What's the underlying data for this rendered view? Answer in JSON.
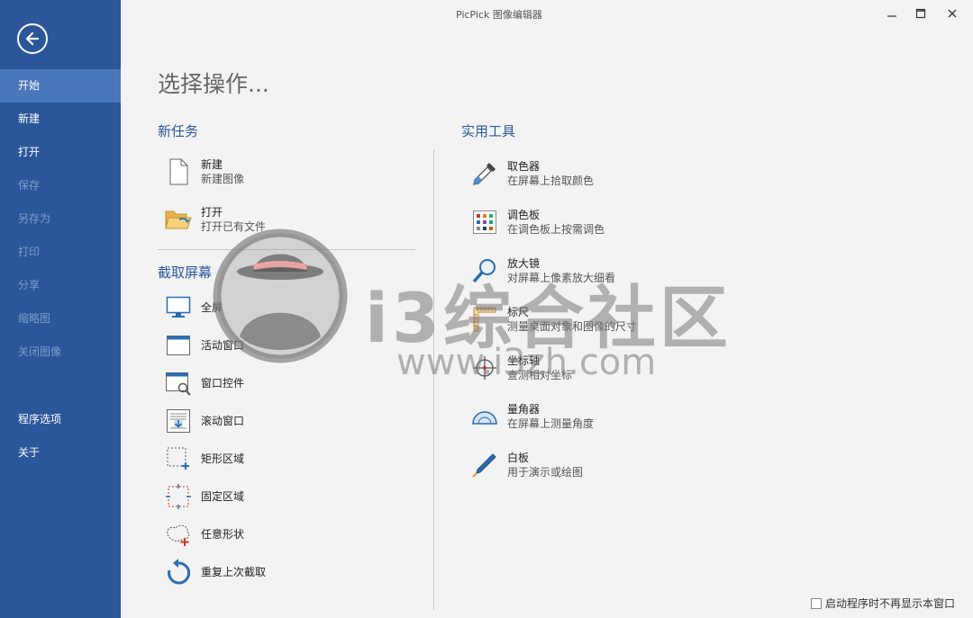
{
  "window": {
    "title": "PicPick 图像编辑器"
  },
  "sidebar": {
    "items": [
      {
        "label": "开始"
      },
      {
        "label": "新建"
      },
      {
        "label": "打开"
      },
      {
        "label": "保存"
      },
      {
        "label": "另存为"
      },
      {
        "label": "打印"
      },
      {
        "label": "分享"
      },
      {
        "label": "缩略图"
      },
      {
        "label": "关闭图像"
      },
      {
        "label": "程序选项"
      },
      {
        "label": "关于"
      }
    ]
  },
  "main": {
    "heading": "选择操作...",
    "new_task": {
      "title": "新任务",
      "items": [
        {
          "name": "新建",
          "desc": "新建图像"
        },
        {
          "name": "打开",
          "desc": "打开已有文件"
        }
      ]
    },
    "capture": {
      "title": "截取屏幕",
      "items": [
        {
          "name": "全屏"
        },
        {
          "name": "活动窗口"
        },
        {
          "name": "窗口控件"
        },
        {
          "name": "滚动窗口"
        },
        {
          "name": "矩形区域"
        },
        {
          "name": "固定区域"
        },
        {
          "name": "任意形状"
        },
        {
          "name": "重复上次截取"
        }
      ]
    },
    "tools": {
      "title": "实用工具",
      "items": [
        {
          "name": "取色器",
          "desc": "在屏幕上拾取颜色"
        },
        {
          "name": "调色板",
          "desc": "在调色板上按需调色"
        },
        {
          "name": "放大镜",
          "desc": "对屏幕上像素放大细看"
        },
        {
          "name": "标尺",
          "desc": "测量桌面对象和图像的尺寸"
        },
        {
          "name": "坐标轴",
          "desc": "查测相对坐标"
        },
        {
          "name": "量角器",
          "desc": "在屏幕上测量角度"
        },
        {
          "name": "白板",
          "desc": "用于演示或绘图"
        }
      ]
    }
  },
  "watermark": {
    "text": "i3综合社区",
    "url": "www.i3zh.com"
  },
  "footer": {
    "checkbox_label": "启动程序时不再显示本窗口"
  },
  "colors": {
    "sidebar": "#2b579a",
    "sidebar_active": "#4a77bc",
    "accent": "#2b579a",
    "background": "#f3f3f3"
  }
}
